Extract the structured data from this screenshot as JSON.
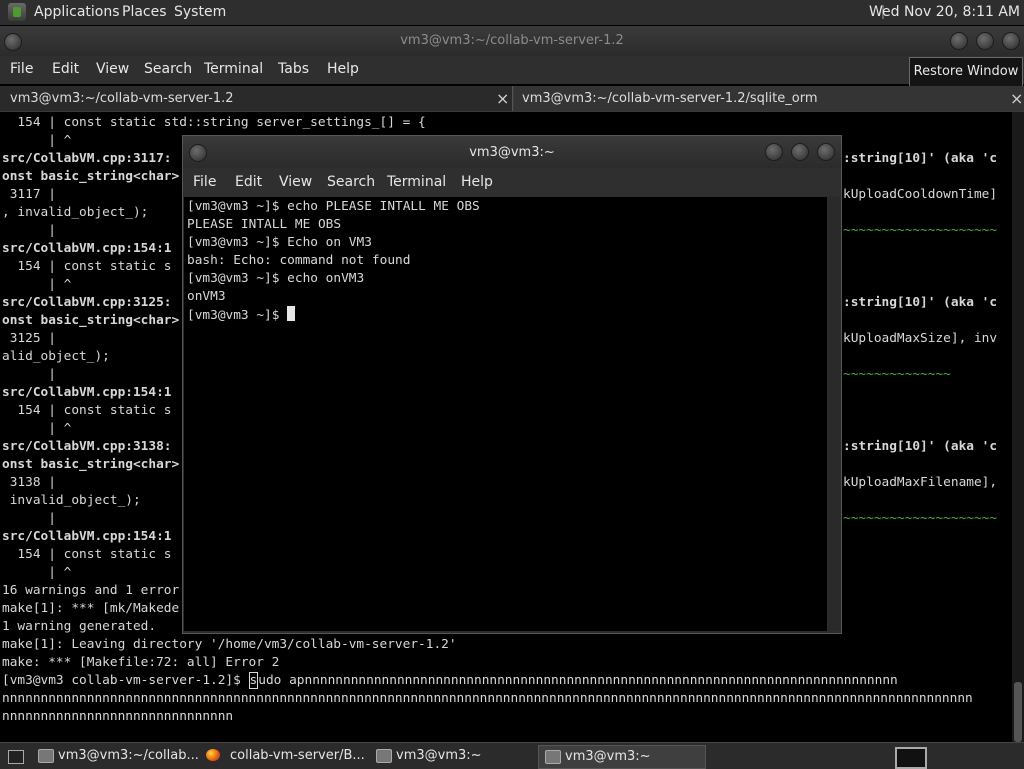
{
  "top_panel": {
    "menus": [
      "Applications",
      "Places",
      "System"
    ],
    "clock": "Wed Nov 20,  8:11 AM"
  },
  "window": {
    "title": "vm3@vm3:~/collab-vm-server-1.2",
    "menu": [
      "File",
      "Edit",
      "View",
      "Search",
      "Terminal",
      "Tabs",
      "Help"
    ],
    "tooltip": "Restore Window",
    "tabs": [
      {
        "label": "vm3@vm3:~/collab-vm-server-1.2",
        "close": "×"
      },
      {
        "label": "vm3@vm3:~/collab-vm-server-1.2/sqlite_orm",
        "close": "×"
      }
    ]
  },
  "bg_terminal": {
    "lines": [
      "  154 | const static std::string server_settings_[] = {",
      "      | ^",
      "src/CollabVM.cpp:3117:",
      "onst basic_string<char>",
      " 3117 |",
      ", invalid_object_);",
      "      |",
      "src/CollabVM.cpp:154:1",
      "  154 | const static s",
      "      | ^",
      "src/CollabVM.cpp:3125:",
      "onst basic_string<char>",
      " 3125 |",
      "alid_object_);",
      "      |",
      "src/CollabVM.cpp:154:1",
      "  154 | const static s",
      "      | ^",
      "src/CollabVM.cpp:3138:",
      "onst basic_string<char>",
      " 3138 |",
      " invalid_object_);",
      "      |",
      "src/CollabVM.cpp:154:1",
      "  154 | const static s",
      "      | ^",
      "16 warnings and 1 error",
      "make[1]: *** [mk/Makede",
      "1 warning generated.",
      "make[1]: Leaving directory '/home/vm3/collab-vm-server-1.2'",
      "make: *** [Makefile:72: all] Error 2"
    ],
    "right_lines": [
      ":string[10]' (aka 'c",
      "kUploadCooldownTime]",
      "~~~~~~~~~~~~~~~~~~~~",
      ":string[10]' (aka 'c",
      "kUploadMaxSize], inv",
      "~~~~~~~~~~~~~~",
      ":string[10]' (aka 'c",
      "kUploadMaxFilename],",
      "~~~~~~~~~~~~~~~~~~~~"
    ],
    "prompt": "[vm3@vm3 collab-vm-server-1.2]$ ",
    "cursor_char": "s",
    "cmd_rest": "udo apnnnnnnnnnnnnnnnnnnnnnnnnnnnnnnnnnnnnnnnnnnnnnnnnnnnnnnnnnnnnnnnnnnnnnnnnnnnnn",
    "wrap1": "nnnnnnnnnnnnnnnnnnnnnnnnnnnnnnnnnnnnnnnnnnnnnnnnnnnnnnnnnnnnnnnnnnnnnnnnnnnnnnnnnnnnnnnnnnnnnnnnnnnnnnnnnnnnnnnnnnnnnnnnnnnnnn",
    "wrap2": "nnnnnnnnnnnnnnnnnnnnnnnnnnnnnn"
  },
  "dialog": {
    "title": "vm3@vm3:~",
    "menu": [
      "File",
      "Edit",
      "View",
      "Search",
      "Terminal",
      "Help"
    ],
    "lines": [
      "[vm3@vm3 ~]$ echo PLEASE INTALL ME OBS",
      "PLEASE INTALL ME OBS",
      "[vm3@vm3 ~]$ Echo on VM3",
      "bash: Echo: command not found",
      "[vm3@vm3 ~]$ echo onVM3",
      "onVM3",
      "[vm3@vm3 ~]$ "
    ]
  },
  "taskbar": {
    "items": [
      {
        "label": "vm3@vm3:~/collab...",
        "icon": "terminal-icon"
      },
      {
        "label": "collab-vm-server/B...",
        "icon": "firefox-icon"
      },
      {
        "label": "vm3@vm3:~",
        "icon": "terminal-icon"
      },
      {
        "label": "vm3@vm3:~",
        "icon": "terminal-icon"
      }
    ]
  }
}
